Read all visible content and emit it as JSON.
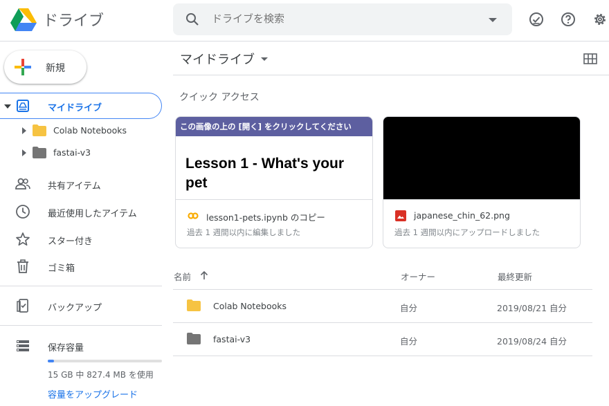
{
  "header": {
    "app_title": "ドライブ",
    "search_placeholder": "ドライブを検索",
    "icons": [
      "drive-logo",
      "search-icon",
      "dropdown-icon",
      "offline-check-icon",
      "help-icon",
      "settings-icon"
    ]
  },
  "sidebar": {
    "new_button": "新規",
    "my_drive": "マイドライブ",
    "tree": [
      {
        "label": "Colab Notebooks",
        "folder_color": "#f6c342"
      },
      {
        "label": "fastai-v3",
        "folder_color": "#757575"
      }
    ],
    "items": [
      {
        "label": "共有アイテム",
        "icon": "shared-icon"
      },
      {
        "label": "最近使用したアイテム",
        "icon": "clock-icon"
      },
      {
        "label": "スター付き",
        "icon": "star-icon"
      },
      {
        "label": "ゴミ箱",
        "icon": "trash-icon"
      }
    ],
    "backup": "バックアップ",
    "storage": {
      "title": "保存容量",
      "used_fraction": 0.055,
      "text": "15 GB 中 827.4 MB を使用",
      "upgrade": "容量をアップグレード"
    }
  },
  "main": {
    "title": "マイドライブ",
    "quick_access_label": "クイック アクセス",
    "cards": [
      {
        "banner": "この画像の上の [開く] をクリックしてください",
        "heading": "Lesson 1 - What's your pet",
        "file_name": "lesson1-pets.ipynb のコピー",
        "meta": "過去 1 週間以内に編集しました",
        "icon": "colab-icon"
      },
      {
        "file_name": "japanese_chin_62.png",
        "meta": "過去 1 週間以内にアップロードしました",
        "icon": "image-file-icon"
      }
    ],
    "list": {
      "columns": {
        "name": "名前",
        "owner": "オーナー",
        "modified": "最終更新"
      },
      "rows": [
        {
          "name": "Colab Notebooks",
          "owner": "自分",
          "modified": "2019/08/21 自分",
          "folder_color": "#f6c342"
        },
        {
          "name": "fastai-v3",
          "owner": "自分",
          "modified": "2019/08/24 自分",
          "folder_color": "#757575"
        }
      ]
    }
  },
  "colors": {
    "accent": "#1a73e8",
    "banner": "#5d5fa0",
    "folder_yellow": "#f6c342",
    "folder_gray": "#757575"
  }
}
